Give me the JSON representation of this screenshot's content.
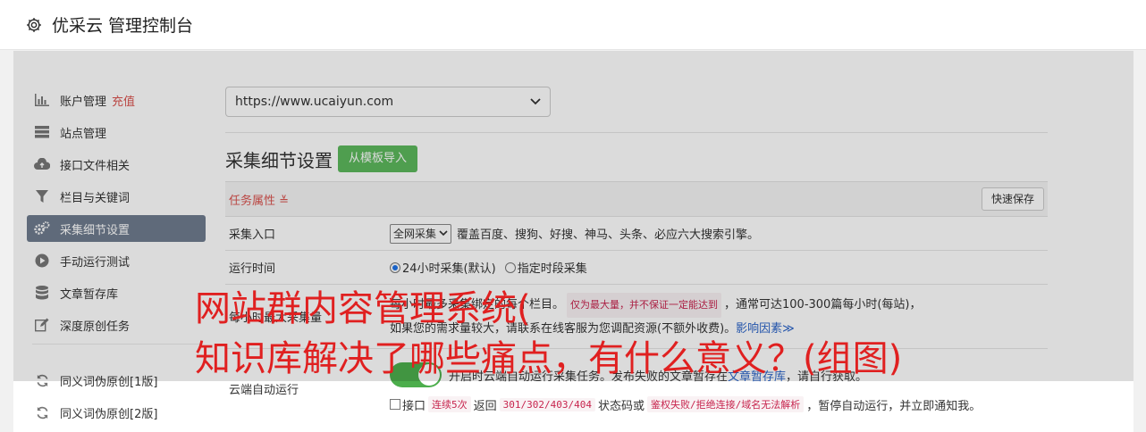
{
  "app": {
    "title": "优采云 管理控制台"
  },
  "sidebar": {
    "items": [
      {
        "label": "账户管理",
        "extra": "充值",
        "icon": "bar-chart-icon"
      },
      {
        "label": "站点管理",
        "icon": "server-icon"
      },
      {
        "label": "接口文件相关",
        "icon": "cloud-upload-icon"
      },
      {
        "label": "栏目与关键词",
        "icon": "filter-icon"
      },
      {
        "label": "采集细节设置",
        "icon": "gears-icon",
        "active": true
      },
      {
        "label": "手动运行测试",
        "icon": "play-circle-icon"
      },
      {
        "label": "文章暂存库",
        "icon": "database-icon"
      },
      {
        "label": "深度原创任务",
        "icon": "edit-icon"
      },
      {
        "label": "同义词伪原创[1版]",
        "icon": "refresh-icon"
      },
      {
        "label": "同义词伪原创[2版]",
        "icon": "refresh-icon"
      }
    ]
  },
  "main": {
    "site_select": "https://www.ucaiyun.com",
    "heading": "采集细节设置",
    "import_button": "从模板导入",
    "task_title": "任务属性 ≚",
    "save_button": "快速保存",
    "rows": {
      "entry": {
        "label": "采集入口",
        "select": "全网采集",
        "desc": "覆盖百度、搜狗、好搜、神马、头条、必应六大搜索引擎。"
      },
      "time": {
        "label": "运行时间",
        "opt1": "24小时采集(默认)",
        "opt2": "指定时段采集"
      },
      "limit": {
        "label": "每小时最大采集量",
        "text1": "每小时最多采集绑定的每个栏目。",
        "code1": "仅为最大量，并不保证一定能达到",
        "text2": "，通常可达100-300篇每小时(每站)，",
        "text3": "如果您的需求量较大，请联系在线客服为您调配资源(不额外收费)。",
        "link": "影响因素≫"
      },
      "cloud": {
        "label": "云端自动运行",
        "text1": "开启时云端自动运行采集任务。发布失败的文章暂存在",
        "link": "文章暂存库",
        "text2": "，请自行获取。",
        "cb_text1": "接口",
        "code1": "连续5次",
        "cb_text2": "返回",
        "code2": "301/302/403/404",
        "cb_text3": "状态码或",
        "code3": "鉴权失败/拒绝连接/域名无法解析",
        "cb_text4": "，暂停自动运行，并立即通知我。"
      }
    }
  },
  "watermark": {
    "line1": "网站群内容管理系统(",
    "line2": "知识库解决了哪些痛点，有什么意义？(组图)"
  }
}
